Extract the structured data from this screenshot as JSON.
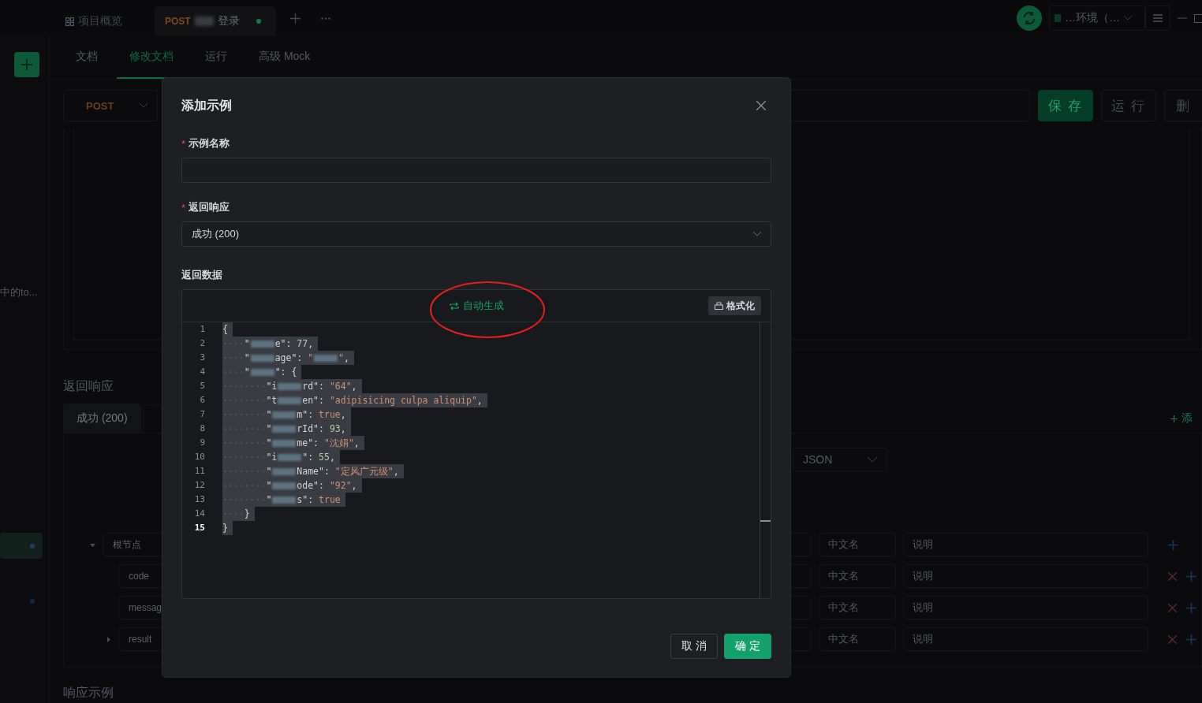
{
  "top_tabs": [
    {
      "kind": "overview",
      "label": "项目概览",
      "selected": false
    },
    {
      "kind": "request",
      "method": "POST",
      "label": "登录",
      "redacted_prefix": true,
      "unsaved": true,
      "selected": true
    }
  ],
  "top_bar": {
    "environment": "…环境（…"
  },
  "sidebar": {
    "items": [
      {
        "label": "中的to..."
      }
    ],
    "markers": [
      {
        "selected": true
      },
      {
        "selected": false
      }
    ]
  },
  "sub_tabs": [
    {
      "label": "文档",
      "selected": false
    },
    {
      "label": "修改文档",
      "selected": true
    },
    {
      "label": "运行",
      "selected": false
    },
    {
      "label": "高级 Mock",
      "selected": false
    }
  ],
  "request": {
    "method": "POST",
    "buttons": [
      {
        "label": "保 存",
        "kind": "primary"
      },
      {
        "label": "运 行",
        "kind": "default"
      },
      {
        "label": "删",
        "kind": "default"
      }
    ]
  },
  "response": {
    "title": "返回响应",
    "tabs": [
      {
        "label": "成功 (200)",
        "selected": true
      }
    ],
    "add_link": "添",
    "format": "JSON",
    "tree": [
      {
        "name": "根节点",
        "cn_placeholder": "中文名",
        "desc_placeholder": "说明",
        "deletable": false,
        "expanded": true,
        "children": [
          {
            "name": "code",
            "cn_placeholder": "中文名",
            "desc_placeholder": "说明",
            "deletable": true
          },
          {
            "name": "messag",
            "cn_placeholder": "中文名",
            "desc_placeholder": "说明",
            "deletable": true
          },
          {
            "name": "result",
            "cn_placeholder": "中文名",
            "desc_placeholder": "说明",
            "deletable": true,
            "expanded": false
          }
        ]
      }
    ]
  },
  "examples_heading": "响应示例",
  "modal": {
    "title": "添加示例",
    "fields": [
      {
        "label": "示例名称",
        "required_mark": "*",
        "kind": "text"
      },
      {
        "label": "返回响应",
        "required_mark": "*",
        "kind": "select",
        "value": "成功 (200)"
      }
    ],
    "data_label": "返回数据",
    "editor": {
      "generate": "自动生成",
      "generate_highlighted": true,
      "format": "格式化",
      "lines": [
        {
          "number": "1",
          "current": false,
          "tokens": [
            {
              "kind": "punct",
              "text": "{"
            }
          ]
        },
        {
          "number": "2",
          "current": false,
          "tokens": [
            {
              "kind": "ws",
              "text": "····"
            },
            {
              "kind": "key",
              "text": "\""
            },
            {
              "kind": "redacted"
            },
            {
              "kind": "key",
              "text": "e\""
            },
            {
              "kind": "punct",
              "text": ": "
            },
            {
              "kind": "number",
              "text": "77"
            },
            {
              "kind": "punct",
              "text": ","
            }
          ]
        },
        {
          "number": "3",
          "current": false,
          "tokens": [
            {
              "kind": "ws",
              "text": "····"
            },
            {
              "kind": "key",
              "text": "\""
            },
            {
              "kind": "redacted"
            },
            {
              "kind": "key",
              "text": "age\""
            },
            {
              "kind": "punct",
              "text": ": "
            },
            {
              "kind": "string",
              "text": "\""
            },
            {
              "kind": "redacted"
            },
            {
              "kind": "string",
              "text": "\""
            },
            {
              "kind": "punct",
              "text": ","
            }
          ]
        },
        {
          "number": "4",
          "current": false,
          "tokens": [
            {
              "kind": "ws",
              "text": "····"
            },
            {
              "kind": "key",
              "text": "\""
            },
            {
              "kind": "redacted"
            },
            {
              "kind": "key",
              "text": "\""
            },
            {
              "kind": "punct",
              "text": ": {"
            }
          ]
        },
        {
          "number": "5",
          "current": false,
          "tokens": [
            {
              "kind": "ws",
              "text": "········"
            },
            {
              "kind": "key",
              "text": "\"i"
            },
            {
              "kind": "redacted"
            },
            {
              "kind": "key",
              "text": "rd\""
            },
            {
              "kind": "punct",
              "text": ": "
            },
            {
              "kind": "string",
              "text": "\"64\""
            },
            {
              "kind": "punct",
              "text": ","
            }
          ]
        },
        {
          "number": "6",
          "current": false,
          "tokens": [
            {
              "kind": "ws",
              "text": "········"
            },
            {
              "kind": "key",
              "text": "\"t"
            },
            {
              "kind": "redacted"
            },
            {
              "kind": "key",
              "text": "en\""
            },
            {
              "kind": "punct",
              "text": ": "
            },
            {
              "kind": "string",
              "text": "\"adipisicing culpa aliquip\""
            },
            {
              "kind": "punct",
              "text": ","
            }
          ]
        },
        {
          "number": "7",
          "current": false,
          "tokens": [
            {
              "kind": "ws",
              "text": "········"
            },
            {
              "kind": "key",
              "text": "\""
            },
            {
              "kind": "redacted"
            },
            {
              "kind": "key",
              "text": "m\""
            },
            {
              "kind": "punct",
              "text": ": "
            },
            {
              "kind": "bool",
              "text": "true"
            },
            {
              "kind": "punct",
              "text": ","
            }
          ]
        },
        {
          "number": "8",
          "current": false,
          "tokens": [
            {
              "kind": "ws",
              "text": "········"
            },
            {
              "kind": "key",
              "text": "\""
            },
            {
              "kind": "redacted"
            },
            {
              "kind": "key",
              "text": "rId\""
            },
            {
              "kind": "punct",
              "text": ": "
            },
            {
              "kind": "number",
              "text": "93"
            },
            {
              "kind": "punct",
              "text": ","
            }
          ]
        },
        {
          "number": "9",
          "current": false,
          "tokens": [
            {
              "kind": "ws",
              "text": "········"
            },
            {
              "kind": "key",
              "text": "\""
            },
            {
              "kind": "redacted"
            },
            {
              "kind": "key",
              "text": "me\""
            },
            {
              "kind": "punct",
              "text": ": "
            },
            {
              "kind": "string",
              "text": "\"沈娟\""
            },
            {
              "kind": "punct",
              "text": ","
            }
          ]
        },
        {
          "number": "10",
          "current": false,
          "tokens": [
            {
              "kind": "ws",
              "text": "········"
            },
            {
              "kind": "key",
              "text": "\"i"
            },
            {
              "kind": "redacted"
            },
            {
              "kind": "key",
              "text": "\""
            },
            {
              "kind": "punct",
              "text": ": "
            },
            {
              "kind": "number",
              "text": "55"
            },
            {
              "kind": "punct",
              "text": ","
            }
          ]
        },
        {
          "number": "11",
          "current": false,
          "tokens": [
            {
              "kind": "ws",
              "text": "········"
            },
            {
              "kind": "key",
              "text": "\""
            },
            {
              "kind": "redacted"
            },
            {
              "kind": "key",
              "text": "Name\""
            },
            {
              "kind": "punct",
              "text": ": "
            },
            {
              "kind": "string",
              "text": "\"定风广元级\""
            },
            {
              "kind": "punct",
              "text": ","
            }
          ]
        },
        {
          "number": "12",
          "current": false,
          "tokens": [
            {
              "kind": "ws",
              "text": "········"
            },
            {
              "kind": "key",
              "text": "\""
            },
            {
              "kind": "redacted"
            },
            {
              "kind": "key",
              "text": "ode\""
            },
            {
              "kind": "punct",
              "text": ": "
            },
            {
              "kind": "string",
              "text": "\"92\""
            },
            {
              "kind": "punct",
              "text": ","
            }
          ]
        },
        {
          "number": "13",
          "current": false,
          "tokens": [
            {
              "kind": "ws",
              "text": "········"
            },
            {
              "kind": "key",
              "text": "\""
            },
            {
              "kind": "redacted"
            },
            {
              "kind": "key",
              "text": "s\""
            },
            {
              "kind": "punct",
              "text": ": "
            },
            {
              "kind": "bool",
              "text": "true"
            }
          ]
        },
        {
          "number": "14",
          "current": false,
          "tokens": [
            {
              "kind": "ws",
              "text": "····"
            },
            {
              "kind": "punct",
              "text": "}"
            }
          ]
        },
        {
          "number": "15",
          "current": true,
          "tokens": [
            {
              "kind": "punct",
              "text": "}"
            }
          ]
        }
      ]
    },
    "buttons": [
      {
        "label": "取 消",
        "kind": "default"
      },
      {
        "label": "确 定",
        "kind": "primary"
      }
    ]
  }
}
